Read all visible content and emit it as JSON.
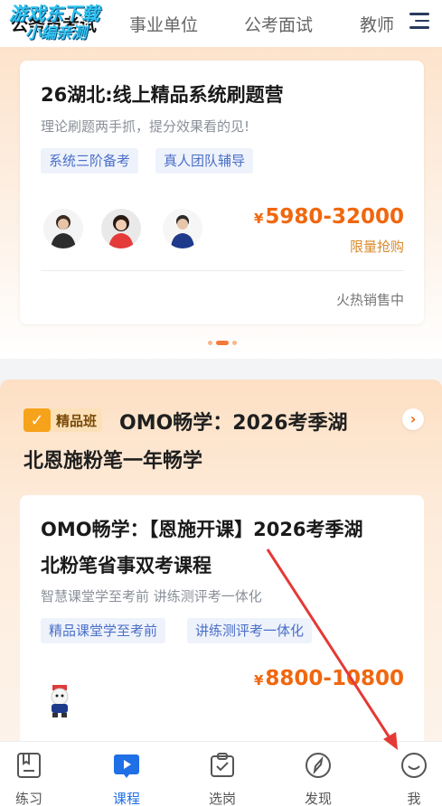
{
  "top_tabs": [
    {
      "label": "公务员考试",
      "active": true
    },
    {
      "label": "事业单位",
      "active": false
    },
    {
      "label": "公考面试",
      "active": false
    },
    {
      "label": "教师",
      "active": false
    }
  ],
  "watermark": {
    "line1": "游戏东下载",
    "line2": "小编亲测"
  },
  "card1": {
    "title": "26湖北:线上精品系统刷题营",
    "subtitle": "理论刷题两手抓，提分效果看的见!",
    "tags": [
      "系统三阶备考",
      "真人团队辅导"
    ],
    "price_symbol": "¥",
    "price": "5980-32000",
    "price_note": "限量抢购",
    "status": "火热销售中"
  },
  "carousel": {
    "count": 3,
    "active_index": 1
  },
  "section2": {
    "badge": "精品班",
    "title_line1": "OMO畅学：2026考季湖",
    "title_line2": "北恩施粉笔一年畅学",
    "arrow": "›"
  },
  "card2": {
    "title_line1": "OMO畅学：【恩施开课】2026考季湖",
    "title_line2": "北粉笔省事双考课程",
    "subtitle": "智慧课堂学至考前 讲练测评考一体化",
    "tags": [
      "精品课堂学至考前",
      "讲练测评考一体化"
    ],
    "price_symbol": "¥",
    "price": "8800-10800"
  },
  "bottom_nav": [
    {
      "label": "练习",
      "icon": "practice-book-icon",
      "active": false
    },
    {
      "label": "课程",
      "icon": "course-play-icon",
      "active": true
    },
    {
      "label": "选岗",
      "icon": "job-select-icon",
      "active": false
    },
    {
      "label": "发现",
      "icon": "discover-compass-icon",
      "active": false
    },
    {
      "label": "我",
      "icon": "profile-icon",
      "active": false
    }
  ],
  "colors": {
    "accent": "#1f6fe6",
    "price": "#f0670f",
    "tag_text": "#4a6fc8",
    "annotation_arrow": "#e53935"
  }
}
